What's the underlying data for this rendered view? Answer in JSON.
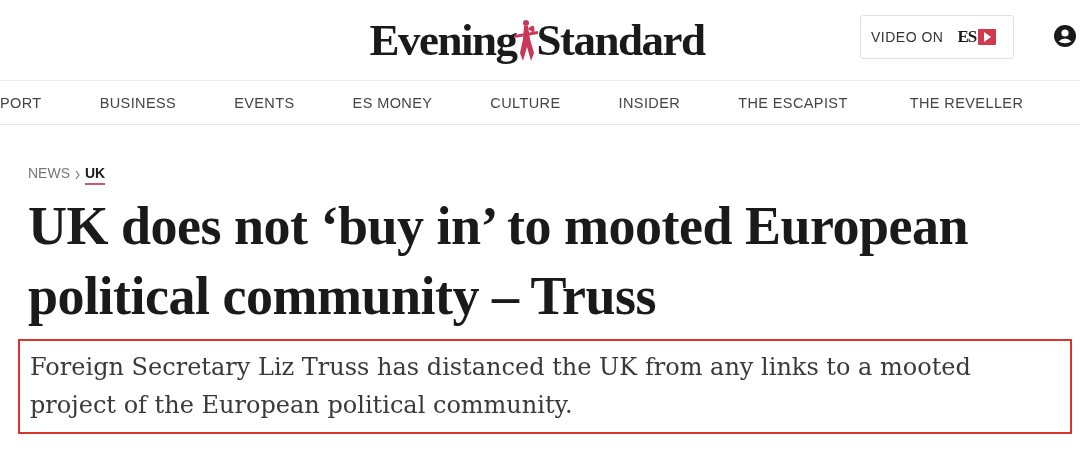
{
  "masthead": {
    "logo_left": "Evening",
    "logo_right": "Standard",
    "video_button": {
      "label": "VIDEO ON",
      "brand": "ES"
    }
  },
  "nav": [
    {
      "label": "PORT"
    },
    {
      "label": "BUSINESS"
    },
    {
      "label": "EVENTS"
    },
    {
      "label": "ES MONEY"
    },
    {
      "label": "CULTURE"
    },
    {
      "label": "INSIDER"
    },
    {
      "label": "THE ESCAPIST"
    },
    {
      "label": "THE REVELLER"
    }
  ],
  "breadcrumb": [
    {
      "label": "NEWS",
      "selected": false
    },
    {
      "label": "UK",
      "selected": true
    }
  ],
  "article": {
    "headline": "UK does not ‘buy in’ to mooted European political community – Truss",
    "standfirst": {
      "text": "Foreign Secretary Liz Truss has distanced the UK from any links to a mooted project of the European political community.",
      "highlighted": true
    }
  }
}
